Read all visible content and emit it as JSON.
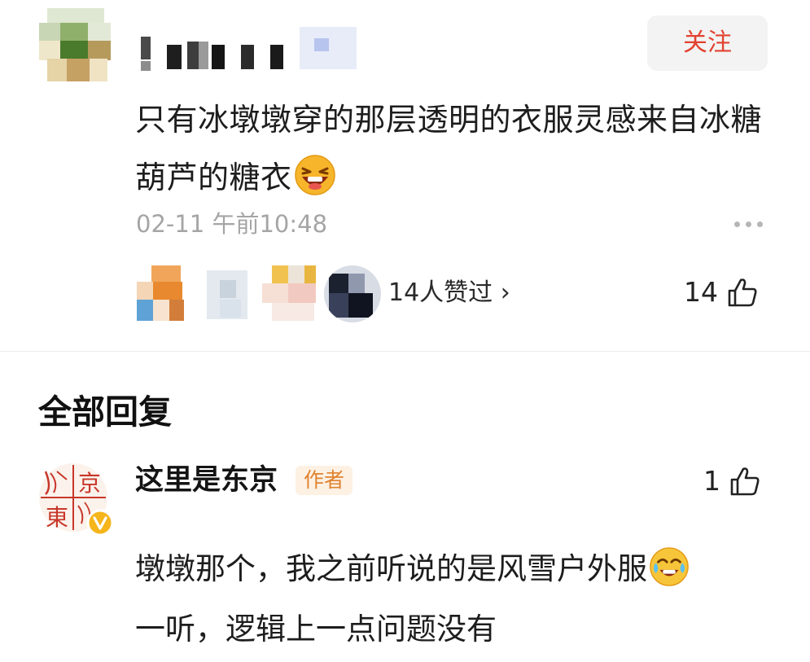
{
  "comment": {
    "follow_label": "关注",
    "text": "只有冰墩墩穿的那层透明的衣服灵感来自冰糖葫芦的糖衣",
    "emoji": "laughing-face-icon",
    "time": "02-11 午前10:48",
    "likers_label": "14人赞过 ›",
    "like_count": "14"
  },
  "section_title": "全部回复",
  "reply": {
    "username": "这里是东京",
    "author_tag": "作者",
    "like_count": "1",
    "text": "墩墩那个，我之前听说的是风雪户外服",
    "text_tail": "一听，逻辑上一点问题没有",
    "emoji": "tears-of-joy-icon",
    "avatar_chars": [
      "京",
      "東"
    ]
  },
  "colors": {
    "follow_text": "#e2422f",
    "author_tag_text": "#e0822f",
    "author_tag_bg": "#fdf1e4",
    "timestamp": "#a5a5a5",
    "verified_badge": "#f5b51b",
    "seal_red": "#c8372a"
  }
}
